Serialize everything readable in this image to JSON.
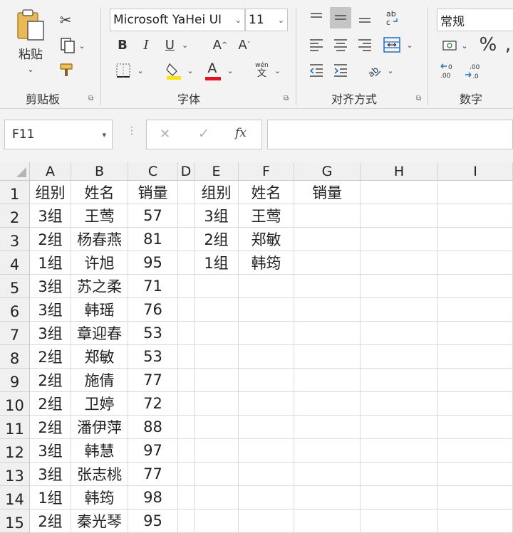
{
  "ribbon": {
    "clipboard": {
      "paste_label": "粘贴",
      "group_label": "剪贴板"
    },
    "font": {
      "font_name": "Microsoft YaHei UI",
      "font_size": "11",
      "group_label": "字体",
      "bold": "B",
      "italic": "I",
      "underline": "U",
      "increase": "A",
      "decrease": "A",
      "font_color": "A",
      "wen_top": "wén",
      "wen_bottom": "文"
    },
    "alignment": {
      "group_label": "对齐方式"
    },
    "number": {
      "format": "常规",
      "percent": "%",
      "group_label": "数字"
    }
  },
  "formula_bar": {
    "name_box": "F11",
    "fx": "fx",
    "cancel": "✕",
    "enter": "✓",
    "content": ""
  },
  "columns": [
    "A",
    "B",
    "C",
    "D",
    "E",
    "F",
    "G",
    "H",
    "I"
  ],
  "rows": [
    {
      "num": "1",
      "a": "组别",
      "b": "姓名",
      "c": "销量",
      "e": "组别",
      "f": "姓名",
      "g": "销量"
    },
    {
      "num": "2",
      "a": "3组",
      "b": "王莺",
      "c": "57",
      "e": "3组",
      "f": "王莺",
      "g": ""
    },
    {
      "num": "3",
      "a": "2组",
      "b": "杨春燕",
      "c": "81",
      "e": "2组",
      "f": "郑敏",
      "g": ""
    },
    {
      "num": "4",
      "a": "1组",
      "b": "许旭",
      "c": "95",
      "e": "1组",
      "f": "韩筠",
      "g": ""
    },
    {
      "num": "5",
      "a": "3组",
      "b": "苏之柔",
      "c": "71",
      "e": "",
      "f": "",
      "g": ""
    },
    {
      "num": "6",
      "a": "3组",
      "b": "韩瑶",
      "c": "76",
      "e": "",
      "f": "",
      "g": ""
    },
    {
      "num": "7",
      "a": "3组",
      "b": "章迎春",
      "c": "53",
      "e": "",
      "f": "",
      "g": ""
    },
    {
      "num": "8",
      "a": "2组",
      "b": "郑敏",
      "c": "53",
      "e": "",
      "f": "",
      "g": ""
    },
    {
      "num": "9",
      "a": "2组",
      "b": "施倩",
      "c": "77",
      "e": "",
      "f": "",
      "g": ""
    },
    {
      "num": "10",
      "a": "2组",
      "b": "卫婷",
      "c": "72",
      "e": "",
      "f": "",
      "g": ""
    },
    {
      "num": "11",
      "a": "2组",
      "b": "潘伊萍",
      "c": "88",
      "e": "",
      "f": "",
      "g": ""
    },
    {
      "num": "12",
      "a": "3组",
      "b": "韩慧",
      "c": "97",
      "e": "",
      "f": "",
      "g": ""
    },
    {
      "num": "13",
      "a": "3组",
      "b": "张志桃",
      "c": "77",
      "e": "",
      "f": "",
      "g": ""
    },
    {
      "num": "14",
      "a": "1组",
      "b": "韩筠",
      "c": "98",
      "e": "",
      "f": "",
      "g": ""
    },
    {
      "num": "15",
      "a": "2组",
      "b": "秦光琴",
      "c": "95",
      "e": "",
      "f": "",
      "g": ""
    }
  ],
  "colors": {
    "ribbon_bg": "#f3f3f3",
    "grid_line": "#dadada",
    "header_bg": "#f0f0f0",
    "font_color_bar": "#e81123",
    "highlight_bar": "#ffe600",
    "accent_blue": "#1e6fc7"
  }
}
